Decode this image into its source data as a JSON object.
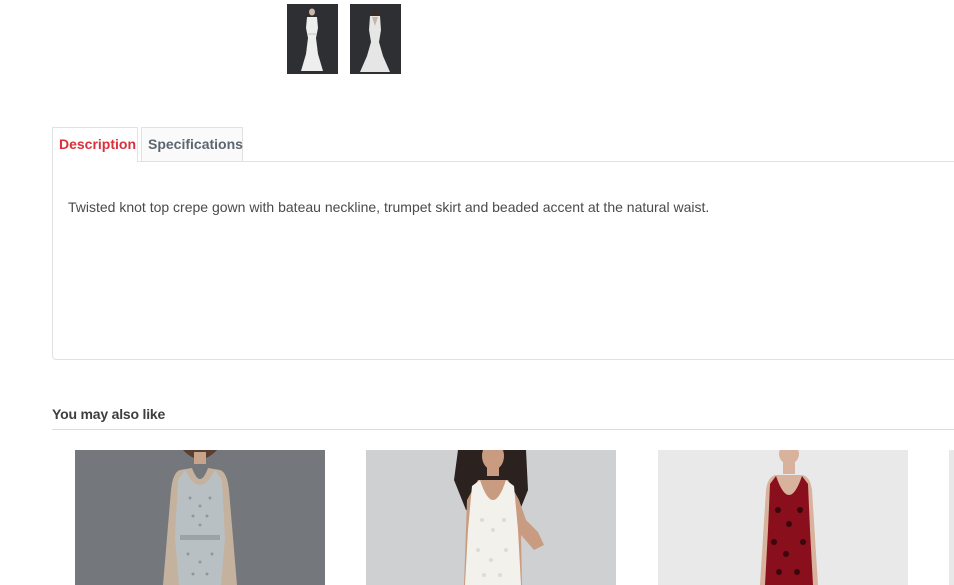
{
  "gallery": {
    "thumbnails": [
      {
        "name": "gown-front-thumbnail",
        "active": true
      },
      {
        "name": "gown-back-thumbnail",
        "active": false
      }
    ]
  },
  "tabs": {
    "description_label": "Description",
    "specifications_label": "Specifications",
    "active": "Description"
  },
  "description": {
    "text": "Twisted knot top crepe gown with bateau neckline, trumpet skirt and beaded accent at the natural waist."
  },
  "recommendations": {
    "title": "You may also like",
    "products": [
      {
        "image": "silver-beaded-gown-image",
        "background": "#74777c",
        "dress_color": "#b9c0c4"
      },
      {
        "image": "white-lace-gown-image",
        "background": "#cfd0d2",
        "dress_color": "#f3f1ec"
      },
      {
        "image": "red-sequin-gown-image",
        "background": "#e9e9ea",
        "dress_color": "#8a0f1c"
      }
    ]
  },
  "colors": {
    "accent": "#d9303c",
    "tab_inactive": "#5c6670",
    "body_text": "#4a4a4a"
  }
}
